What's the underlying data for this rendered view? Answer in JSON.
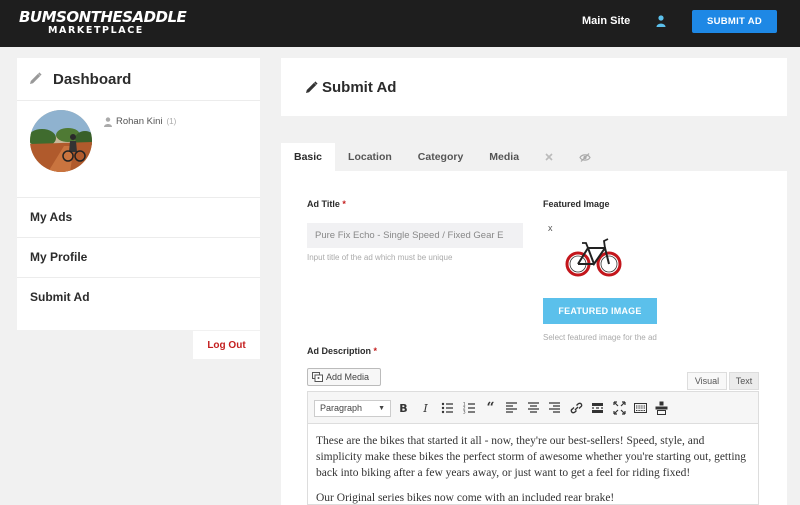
{
  "header": {
    "logo_line1": "BUMSONTHESADDLE",
    "logo_line2": "MARKETPLACE",
    "main_site": "Main Site",
    "submit_ad": "SUBMIT AD"
  },
  "sidebar": {
    "title": "Dashboard",
    "profile_name": "Rohan Kini",
    "profile_count": "(1)",
    "items": [
      {
        "label": "My Ads"
      },
      {
        "label": "My Profile"
      },
      {
        "label": "Submit Ad"
      }
    ],
    "logout": "Log Out"
  },
  "main": {
    "title": "Submit Ad",
    "tabs": [
      {
        "label": "Basic"
      },
      {
        "label": "Location"
      },
      {
        "label": "Category"
      },
      {
        "label": "Media"
      }
    ]
  },
  "form": {
    "ad_title_label": "Ad Title",
    "ad_title_value": "Pure Fix Echo - Single Speed / Fixed Gear E",
    "ad_title_hint": "Input title of the ad which must be unique",
    "featured_label": "Featured Image",
    "remove_x": "x",
    "featured_button": "FEATURED IMAGE",
    "featured_hint": "Select featured image for the ad",
    "desc_label": "Ad Description",
    "add_media": "Add Media",
    "visual_tab": "Visual",
    "text_tab": "Text",
    "paragraph_select": "Paragraph",
    "editor_p1": "These are the bikes that started it all - now, they're our best-sellers! Speed, style, and simplicity make these bikes the perfect storm of awesome whether you're starting out, getting back into biking after a few years away, or just want to get a feel for riding fixed!",
    "editor_p2": "Our Original series bikes now come with an included rear brake!"
  },
  "colors": {
    "accent": "#1e88e5",
    "featured_button": "#5bc0eb",
    "logout": "#c41e1e",
    "topbar": "#1e1e1e"
  }
}
